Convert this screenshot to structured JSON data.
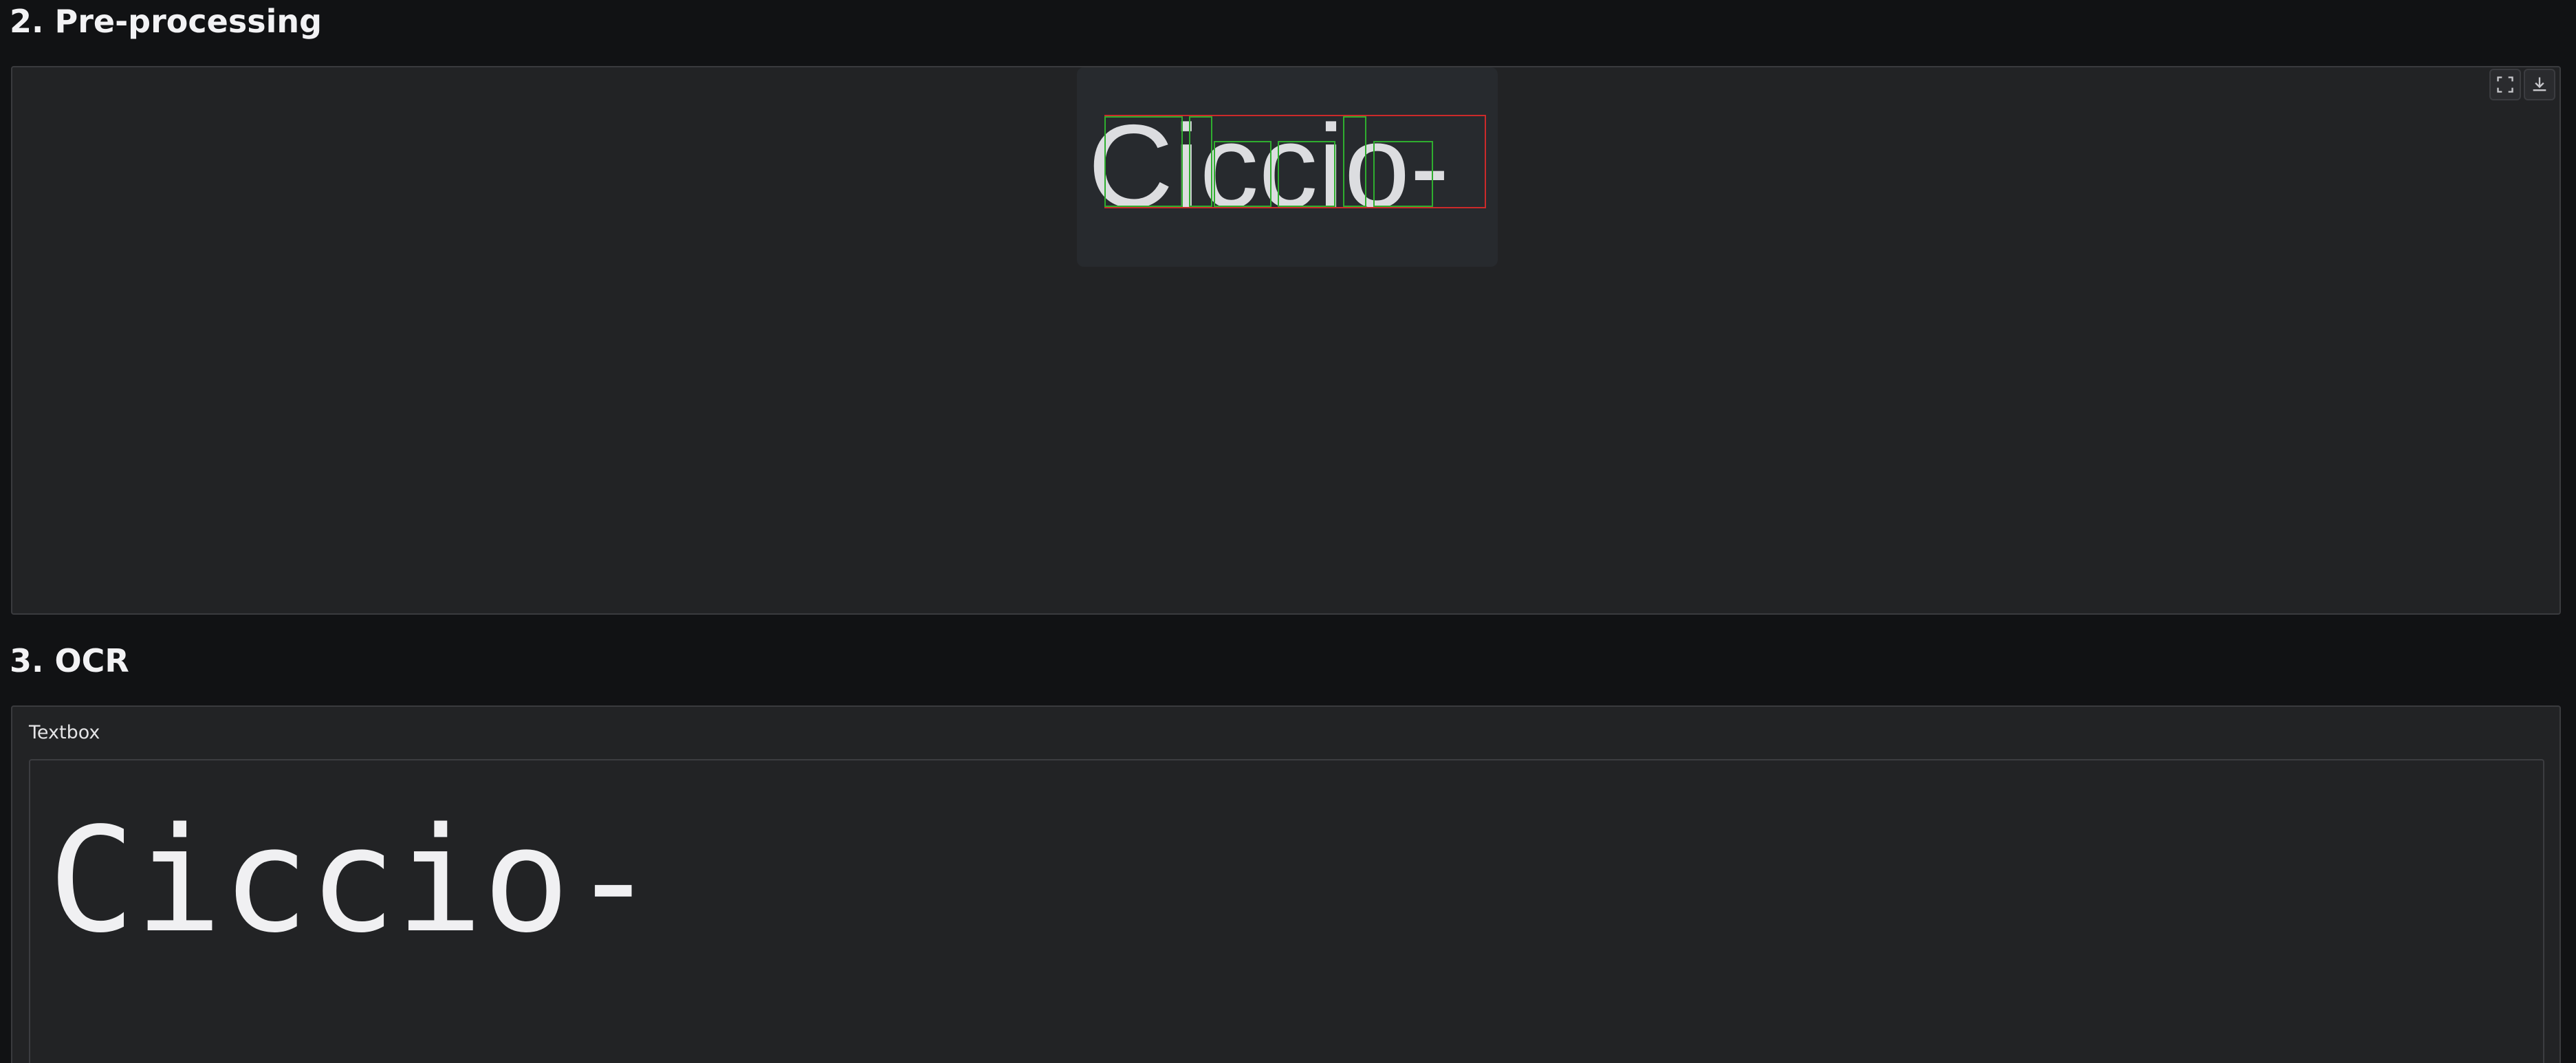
{
  "sections": {
    "preprocessing": {
      "title": "2. Pre-processing",
      "image_text": "Ciccio-",
      "tools": [
        "fullscreen-icon",
        "download-icon"
      ]
    },
    "ocr": {
      "title": "3. OCR",
      "textbox_label": "Textbox",
      "textbox_value": "Ciccio-"
    }
  },
  "colors": {
    "page_bg": "#111214",
    "panel_bg": "#222325",
    "preview_bg": "#272a2e",
    "line_box": "#cc2a2a",
    "char_box": "#2fae2f"
  }
}
